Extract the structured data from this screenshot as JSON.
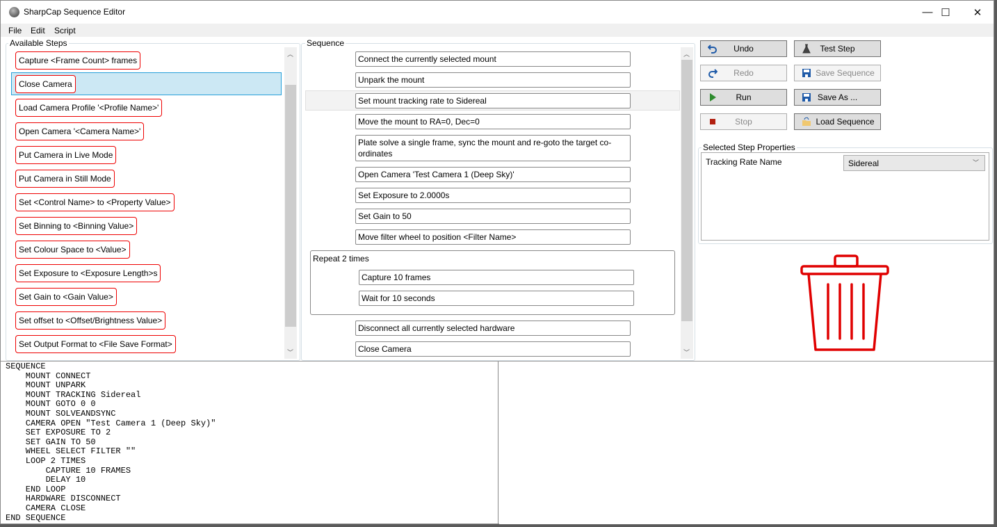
{
  "window": {
    "title": "SharpCap Sequence Editor",
    "minimize": "—",
    "maximize": "☐",
    "close": "✕"
  },
  "menu": [
    "File",
    "Edit",
    "Script"
  ],
  "available_steps": {
    "label": "Available Steps",
    "selected_index": 1,
    "items": [
      "Capture <Frame Count> frames",
      "Close Camera",
      "Load Camera Profile '<Profile Name>'",
      "Open Camera '<Camera Name>'",
      "Put Camera in Live Mode",
      "Put Camera in Still Mode",
      "Set <Control Name> to <Property Value>",
      "Set Binning to <Binning Value>",
      "Set Colour Space to <Value>",
      "Set Exposure to <Exposure Length>s",
      "Set Gain to <Gain Value>",
      "Set offset to <Offset/Brightness Value>",
      "Set Output Format to <File Save Format>"
    ]
  },
  "sequence": {
    "label": "Sequence",
    "selected_index": 2,
    "items_before": [
      "Connect the currently selected mount",
      "Unpark the mount",
      "Set mount tracking rate to Sidereal",
      "Move the mount to RA=0, Dec=0",
      "Plate solve a single frame, sync the mount and re-goto the target co-ordinates",
      "Open Camera 'Test Camera 1 (Deep Sky)'",
      "Set Exposure to 2.0000s",
      "Set Gain to 50",
      "Move filter wheel to position <Filter Name>"
    ],
    "repeat": {
      "label": "Repeat 2 times",
      "items": [
        "Capture 10 frames",
        "Wait for 10 seconds"
      ]
    },
    "items_after": [
      "Disconnect all currently selected hardware",
      "Close Camera"
    ]
  },
  "buttons": {
    "undo": "Undo",
    "redo": "Redo",
    "run": "Run",
    "stop": "Stop",
    "test_step": "Test Step",
    "save_sequence": "Save Sequence",
    "save_as": "Save As ...",
    "load_sequence": "Load Sequence",
    "disabled": [
      "Redo",
      "Stop",
      "Save Sequence"
    ]
  },
  "properties": {
    "label": "Selected Step Properties",
    "name": "Tracking Rate Name",
    "value": "Sidereal"
  },
  "trash_color": "#e00000",
  "script": "SEQUENCE\n    MOUNT CONNECT\n    MOUNT UNPARK\n    MOUNT TRACKING Sidereal\n    MOUNT GOTO 0 0\n    MOUNT SOLVEANDSYNC\n    CAMERA OPEN \"Test Camera 1 (Deep Sky)\"\n    SET EXPOSURE TO 2\n    SET GAIN TO 50\n    WHEEL SELECT FILTER \"\"\n    LOOP 2 TIMES\n        CAPTURE 10 FRAMES\n        DELAY 10\n    END LOOP\n    HARDWARE DISCONNECT\n    CAMERA CLOSE\nEND SEQUENCE"
}
